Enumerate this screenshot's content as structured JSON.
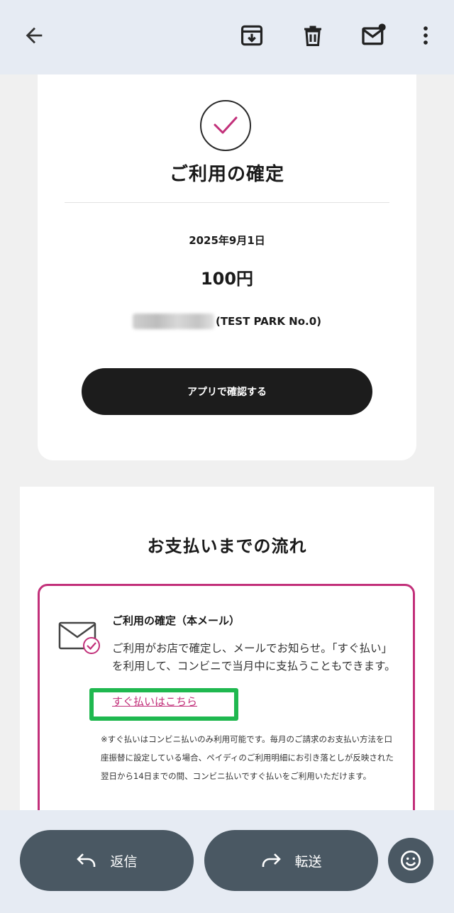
{
  "colors": {
    "accent": "#c2307a",
    "button_dark": "#1c1c1c",
    "highlight": "#1fb84f",
    "bar_bg": "#e6ebf3",
    "pill_bg": "#4a5863"
  },
  "toolbar": {
    "icons": [
      "back-arrow-icon",
      "archive-icon",
      "delete-icon",
      "mark-unread-icon",
      "more-vert-icon"
    ]
  },
  "confirmation": {
    "icon": "check-icon",
    "title": "ご利用の確定",
    "date": "2025年9月1日",
    "amount": "100円",
    "merchant_suffix": "(TEST PARK No.0)",
    "app_button_label": "アプリで確認する"
  },
  "flow": {
    "title": "お支払いまでの流れ",
    "step_icon": "mail-check-icon",
    "step_title": "ご利用の確定（本メール）",
    "step_desc": "ご利用がお店で確定し、メールでお知らせ。「すぐ払い」を利用して、コンビニで当月中に支払うこともできます。",
    "paynow_link": "すぐ払いはこちら",
    "note": "※すぐ払いはコンビニ払いのみ利用可能です。毎月のご請求のお支払い方法を口座振替に設定している場合、ペイディのご利用明細にお引き落としが反映された翌日から14日までの間、コンビニ払いですぐ払いをご利用いただけます。"
  },
  "bottom": {
    "reply_label": "返信",
    "forward_label": "転送",
    "emoji_icon": "emoji-icon"
  }
}
